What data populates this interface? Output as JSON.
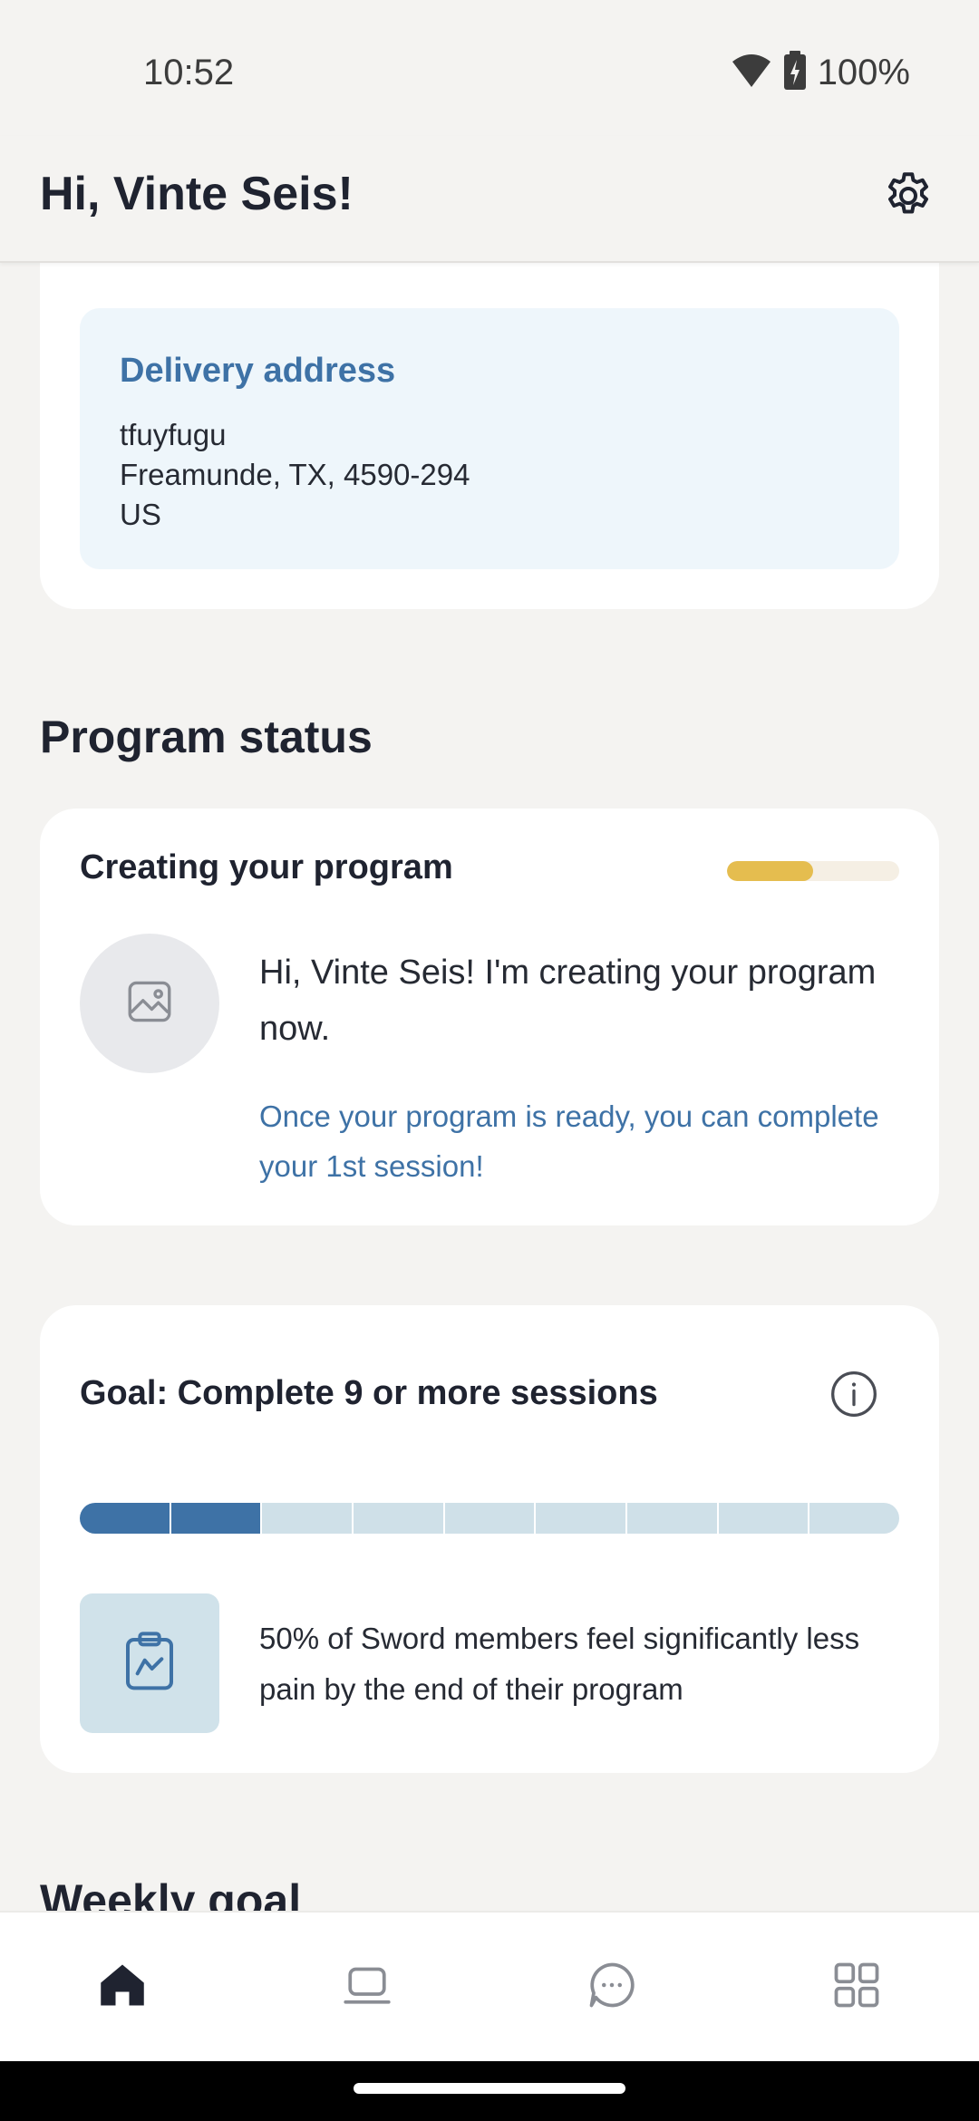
{
  "status_bar": {
    "time": "10:52",
    "battery": "100%",
    "icons": [
      "wifi-icon",
      "battery-charging-icon"
    ]
  },
  "header": {
    "greeting": "Hi, Vinte Seis!",
    "settings_icon": "gear-icon"
  },
  "delivery": {
    "title": "Delivery address",
    "line1": "tfuyfugu",
    "line2": "Freamunde, TX, 4590-294",
    "line3": "US"
  },
  "program_status": {
    "section_title": "Program status",
    "card_title": "Creating your program",
    "progress_fraction": 0.5,
    "message": "Hi, Vinte Seis! I'm creating your program now.",
    "note": "Once your program is ready, you can complete your 1st session!",
    "avatar_icon": "image-placeholder-icon"
  },
  "goal": {
    "title": "Goal: Complete 9 or more sessions",
    "info_icon": "info-icon",
    "total_segments": 9,
    "completed_segments": 2,
    "fact": "50% of Sword members feel significantly less pain by the end of their program",
    "fact_icon": "clipboard-chart-icon"
  },
  "weekly": {
    "section_title": "Weekly goal"
  },
  "bottom_nav": {
    "items": [
      {
        "icon": "home-icon",
        "active": true
      },
      {
        "icon": "laptop-icon",
        "active": false
      },
      {
        "icon": "chat-icon",
        "active": false
      },
      {
        "icon": "grid-icon",
        "active": false
      }
    ]
  },
  "colors": {
    "accent": "#3e72a6",
    "progress_yellow": "#e5bd4f",
    "background": "#f4f3f1"
  }
}
